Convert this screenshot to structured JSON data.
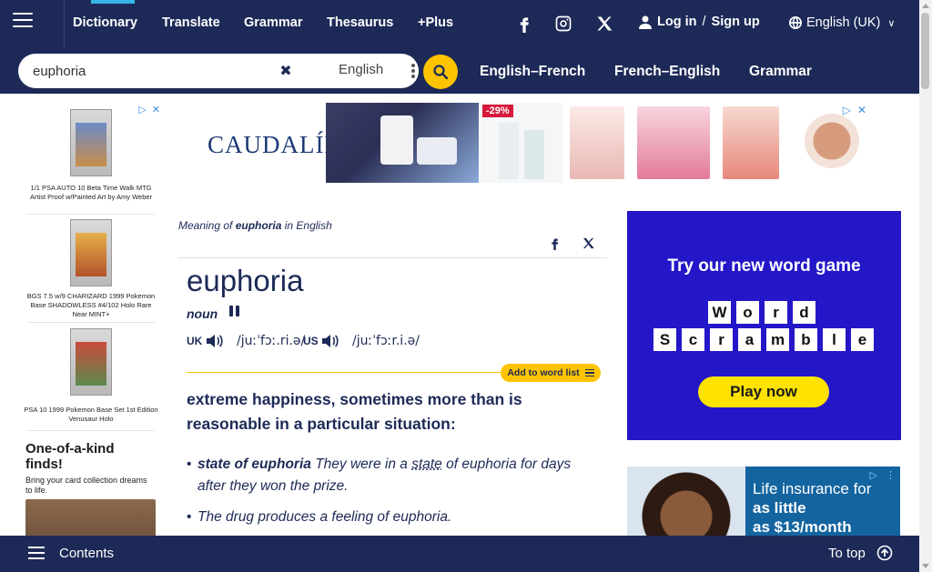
{
  "topnav": {
    "items": [
      {
        "label": "Dictionary"
      },
      {
        "label": "Translate"
      },
      {
        "label": "Grammar"
      },
      {
        "label": "Thesaurus"
      },
      {
        "label": "+Plus"
      }
    ],
    "social": [
      "facebook-icon",
      "instagram-icon",
      "x-icon"
    ],
    "login": "Log in",
    "slash": "/",
    "signup": "Sign up",
    "language": "English (UK)"
  },
  "search": {
    "value": "euphoria",
    "dictionary": "English",
    "subnav": [
      "English–French",
      "French–English",
      "Grammar"
    ]
  },
  "side_ad": {
    "items": [
      {
        "caption": "1/1 PSA AUTO 10 Beta Time Walk MTG Artist Proof w/Painted Art by Amy Weber"
      },
      {
        "caption": "BGS 7.5 w/9 CHARIZARD 1999 Pokemon Base SHADOWLESS #4/102 Holo Rare Near MINT+"
      },
      {
        "caption": "PSA 10 1999 Pokemon Base Set 1st Edition Venusaur Holo"
      }
    ],
    "promo_title": "One-of-a-kind finds!",
    "promo_text": "Bring your card collection dreams to life."
  },
  "banner_ad": {
    "brand": "CAUDALÍE",
    "discount": "-29%"
  },
  "entry": {
    "meaning_prefix": "Meaning of",
    "meaning_word": "euphoria",
    "meaning_suffix": "in English",
    "headword": "euphoria",
    "pos": "noun",
    "uk_label": "UK",
    "uk_ipa": "/juːˈfɔː.ri.ə/",
    "us_label": "US",
    "us_ipa": "/juːˈfɔːr.i.ə/",
    "add_to_list": "Add to word list",
    "definition": {
      "w1": "extreme",
      "w2": "happiness",
      "w3": ", sometimes more than is",
      "w4": "reasonable",
      "w5": "in a",
      "w6": "particular",
      "w7": "situation",
      "w8": ":"
    },
    "examples": [
      {
        "bold": "state of euphoria",
        "rest_a": "They",
        "rest_b": "were in a",
        "link": "state",
        "rest_c": "of euphoria for",
        "line2_a": "days",
        "line2_b": "after they",
        "line2_c": "won",
        "line2_d": "the",
        "line2_e": "prize",
        "line2_f": "."
      },
      {
        "a": "The",
        "b": "drug",
        "c": "produces",
        "d": "a",
        "e": "feeling",
        "f": "of euphoria."
      }
    ]
  },
  "game_ad": {
    "title": "Try our new word game",
    "row1": [
      "W",
      "o",
      "r",
      "d"
    ],
    "row2": [
      "S",
      "c",
      "r",
      "a",
      "m",
      "b",
      "l",
      "e"
    ],
    "button": "Play now"
  },
  "insurance_ad": {
    "line1": "Life insurance for",
    "line2": "as little",
    "line3": "as $13/month"
  },
  "bottom": {
    "contents": "Contents",
    "to_top": "To top"
  },
  "colors": {
    "brand_navy": "#1d2a57",
    "accent_yellow": "#fec400",
    "active_tab": "#36b6e8",
    "game_ad_bg": "#2417c8"
  }
}
